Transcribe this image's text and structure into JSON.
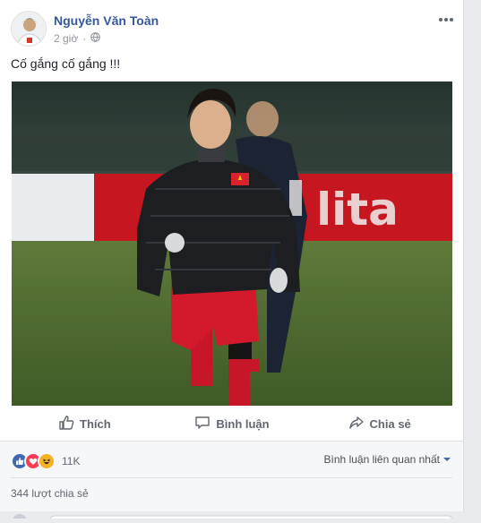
{
  "post": {
    "author": "Nguyễn Văn Toàn",
    "time": "2 giờ",
    "privacy_icon": "globe-icon",
    "text": "Cố gắng cố gắng !!!",
    "more_icon": "ellipsis-icon"
  },
  "actions": {
    "like": "Thích",
    "comment": "Bình luận",
    "share": "Chia sẻ"
  },
  "stats": {
    "reactions": [
      "like-icon",
      "love-icon",
      "haha-icon"
    ],
    "reaction_count": "11K",
    "sort_label": "Bình luận liên quan nhất",
    "shares": "344 lượt chia sẻ"
  },
  "colors": {
    "link": "#365899",
    "like": "#4267b2",
    "love": "#f33e58",
    "haha": "#f7b125"
  }
}
